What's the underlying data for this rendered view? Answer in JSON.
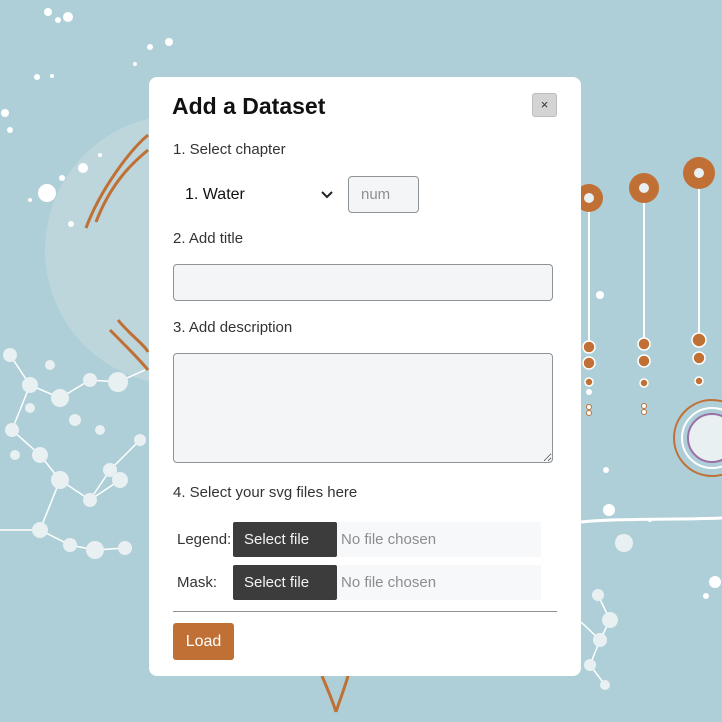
{
  "colors": {
    "background": "#aecfd7",
    "accent": "#c07034",
    "file_button": "#3c3c3c"
  },
  "modal": {
    "title": "Add a Dataset",
    "close_label": "×",
    "step1_label": "1. Select chapter",
    "chapter_selected": "1. Water",
    "chapter_chevron_icon": "chevron-down-icon",
    "num_placeholder": "num",
    "step2_label": "2. Add title",
    "title_value": "",
    "step3_label": "3. Add description",
    "description_value": "",
    "step4_label": "4. Select your svg files here",
    "legend_label": "Legend:",
    "mask_label": "Mask:",
    "select_file_label": "Select file",
    "no_file_label": "No file chosen",
    "load_label": "Load"
  }
}
